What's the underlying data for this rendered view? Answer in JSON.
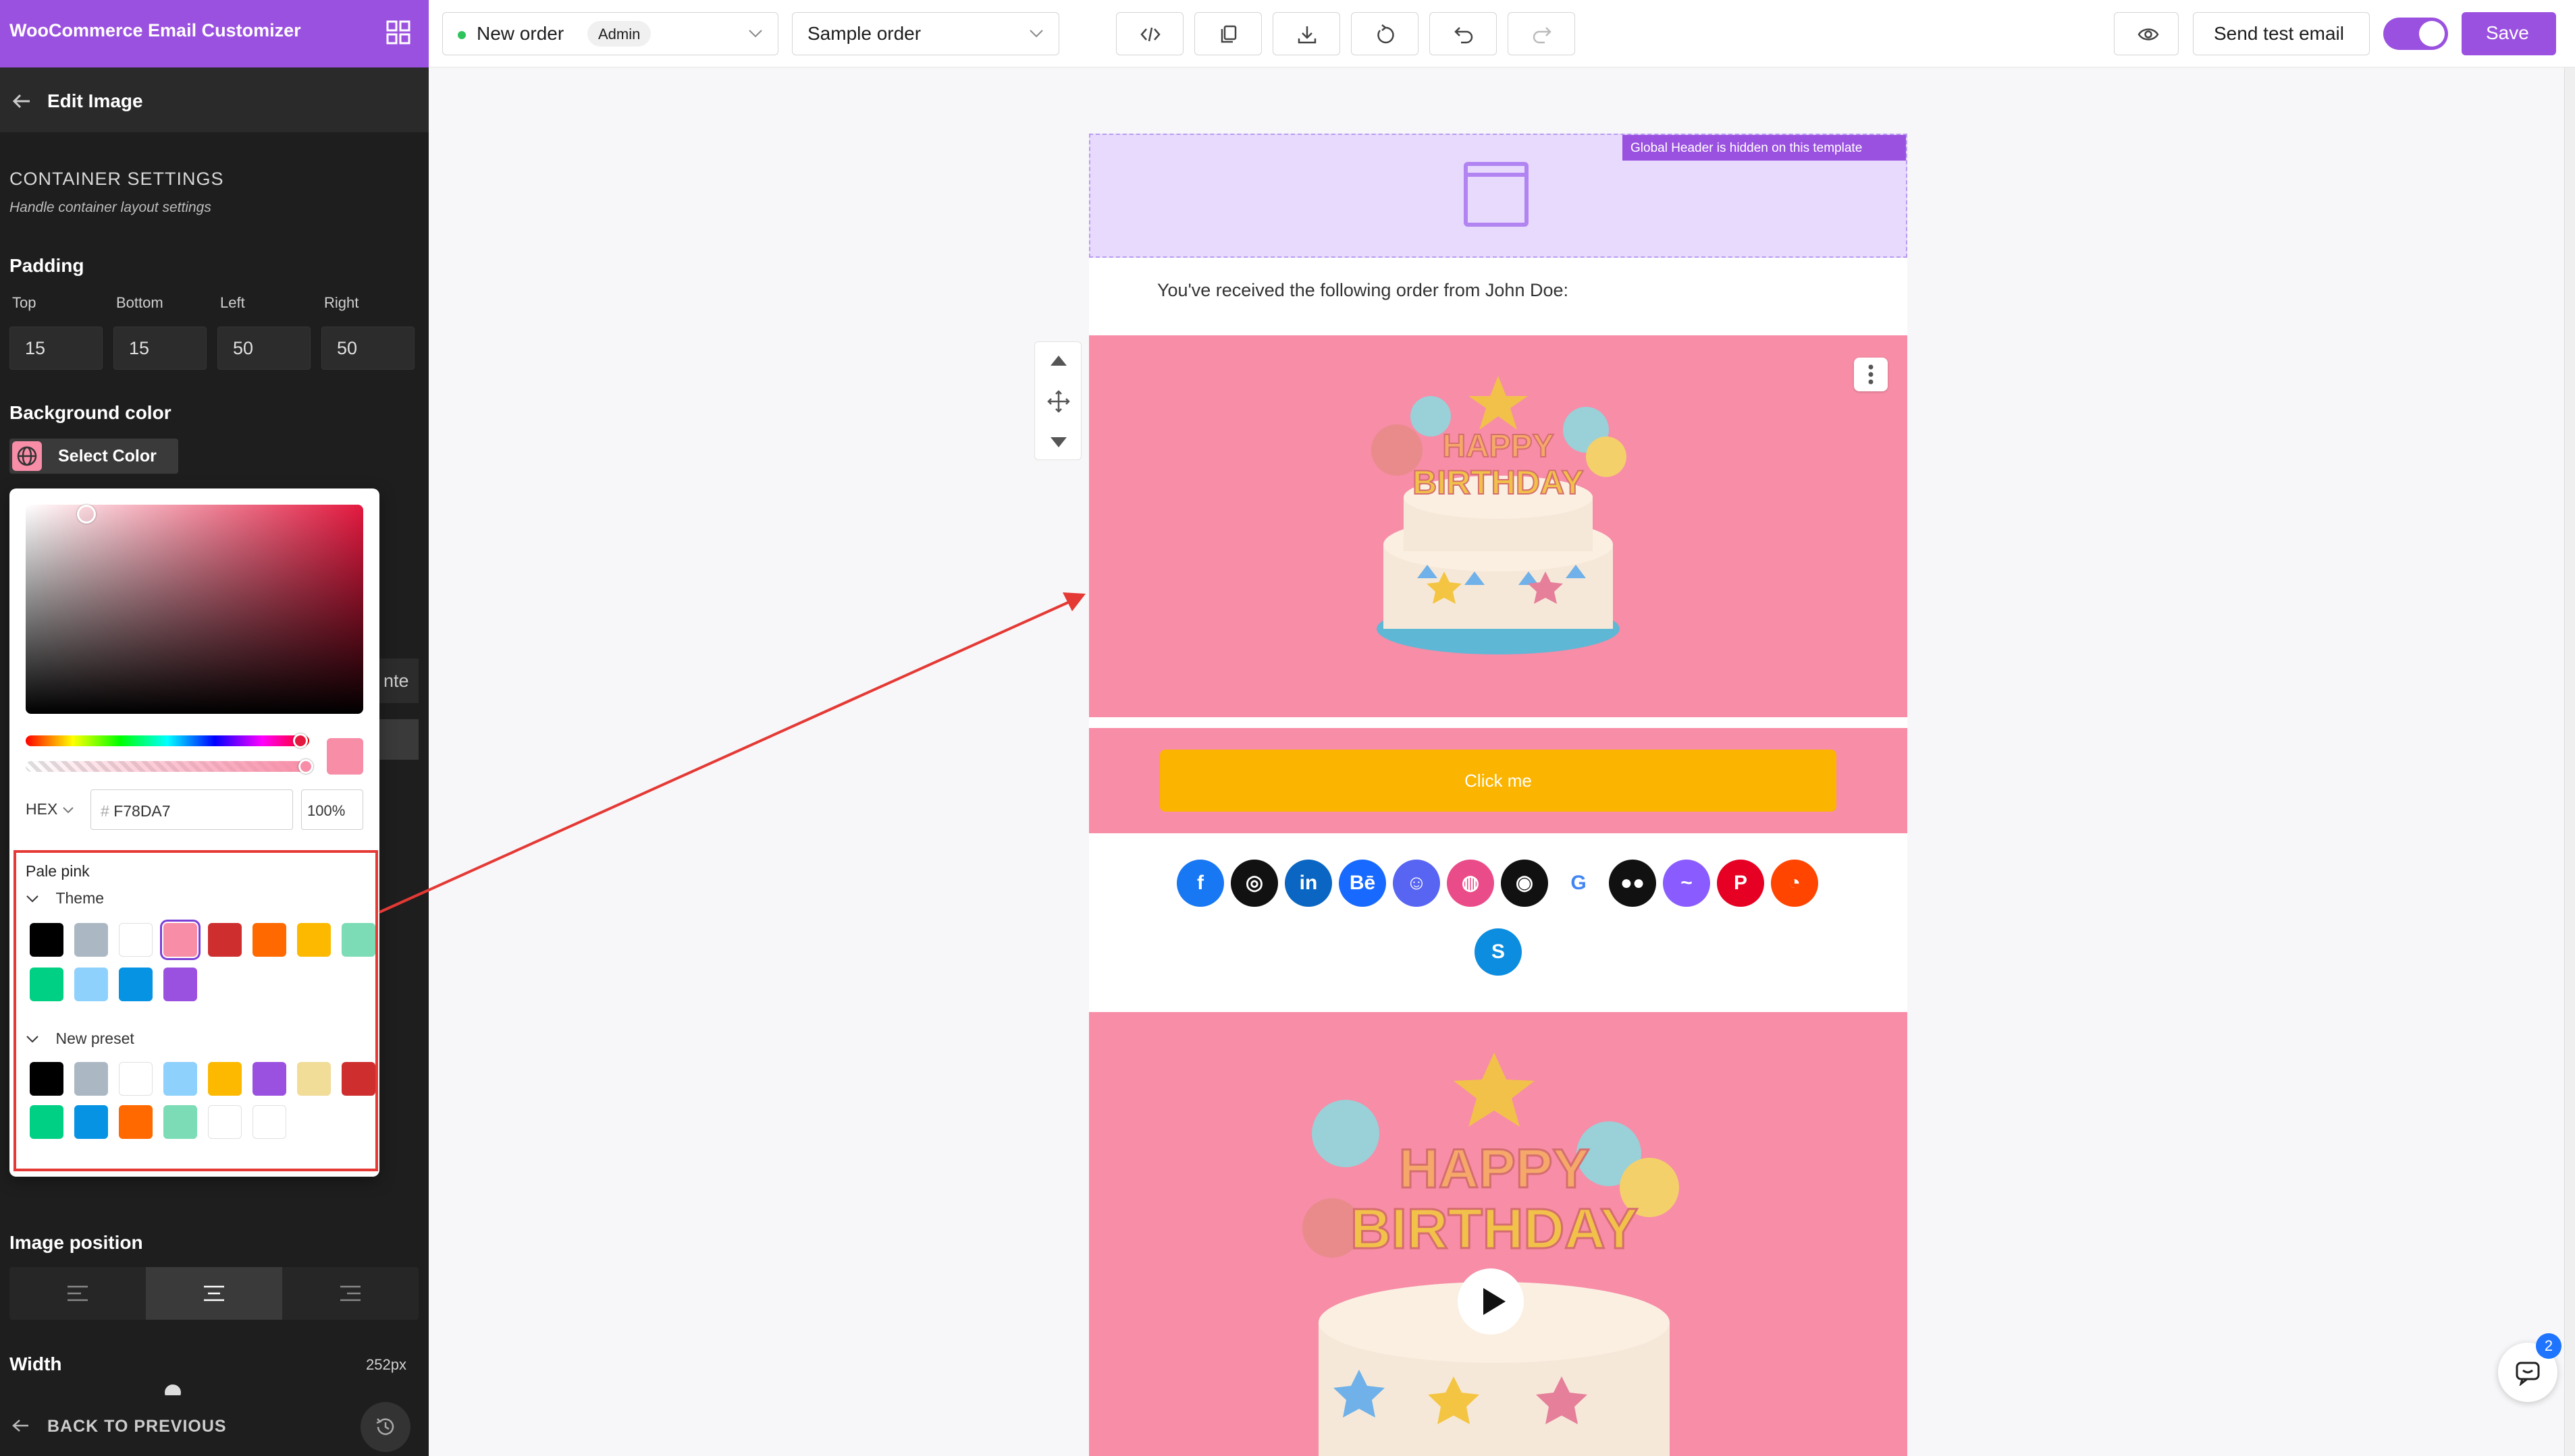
{
  "app": {
    "title": "WooCommerce Email Customizer"
  },
  "sidebar": {
    "header_title": "Edit Image",
    "container_settings": {
      "title": "CONTAINER SETTINGS",
      "subtitle": "Handle container layout settings"
    },
    "padding": {
      "label": "Padding",
      "fields": [
        {
          "label": "Top",
          "value": "15"
        },
        {
          "label": "Bottom",
          "value": "15"
        },
        {
          "label": "Left",
          "value": "50"
        },
        {
          "label": "Right",
          "value": "50"
        }
      ]
    },
    "background_color": {
      "label": "Background color",
      "button_label": "Select Color",
      "color": "#f78da7"
    },
    "partial_text": "nte",
    "image_position": {
      "label": "Image position",
      "options": [
        "left",
        "center",
        "right"
      ],
      "selected": "center"
    },
    "width": {
      "label": "Width",
      "value": "252px"
    },
    "back_label": "BACK TO PREVIOUS"
  },
  "color_picker": {
    "hex_label": "HEX",
    "hex_value": "F78DA7",
    "hex_prefix": "#",
    "alpha_value": "100%",
    "selected_name": "Pale pink",
    "groups": [
      {
        "name": "Theme",
        "swatches": [
          "#000000",
          "#abb8c3",
          "#ffffff",
          "#f78da7",
          "#cf2e2e",
          "#ff6900",
          "#fcb900",
          "#7bdcb5",
          "#00d084",
          "#8ed1fc",
          "#0693e3",
          "#9b51e0"
        ],
        "selected_index": 3
      },
      {
        "name": "New preset",
        "swatches": [
          "#000000",
          "#abb8c3",
          "#ffffff",
          "#8ed1fc",
          "#fcb900",
          "#9b51e0",
          "#f1dc98",
          "#cf2e2e",
          "#00d084",
          "#0693e3",
          "#ff6900",
          "#7bdcb5",
          "#ffffff",
          "#ffffff"
        ]
      }
    ]
  },
  "toolbar": {
    "email_type": "New order",
    "recipient_badge": "Admin",
    "order_select": "Sample order",
    "send_test_label": "Send test email",
    "save_label": "Save",
    "toggle_on": true
  },
  "email": {
    "global_header_badge": "Global Header is hidden on this template",
    "received_text": "You've received the following order from John Doe:",
    "button_label": "Click me",
    "socials": [
      "facebook",
      "instagram",
      "linkedin",
      "behance",
      "discord",
      "dribbble",
      "github",
      "google",
      "medium",
      "messenger",
      "pinterest",
      "reddit",
      "skype"
    ],
    "image_bg": "#f78da7",
    "button_bg": "#fcb900"
  },
  "chat": {
    "badge_count": "2"
  }
}
